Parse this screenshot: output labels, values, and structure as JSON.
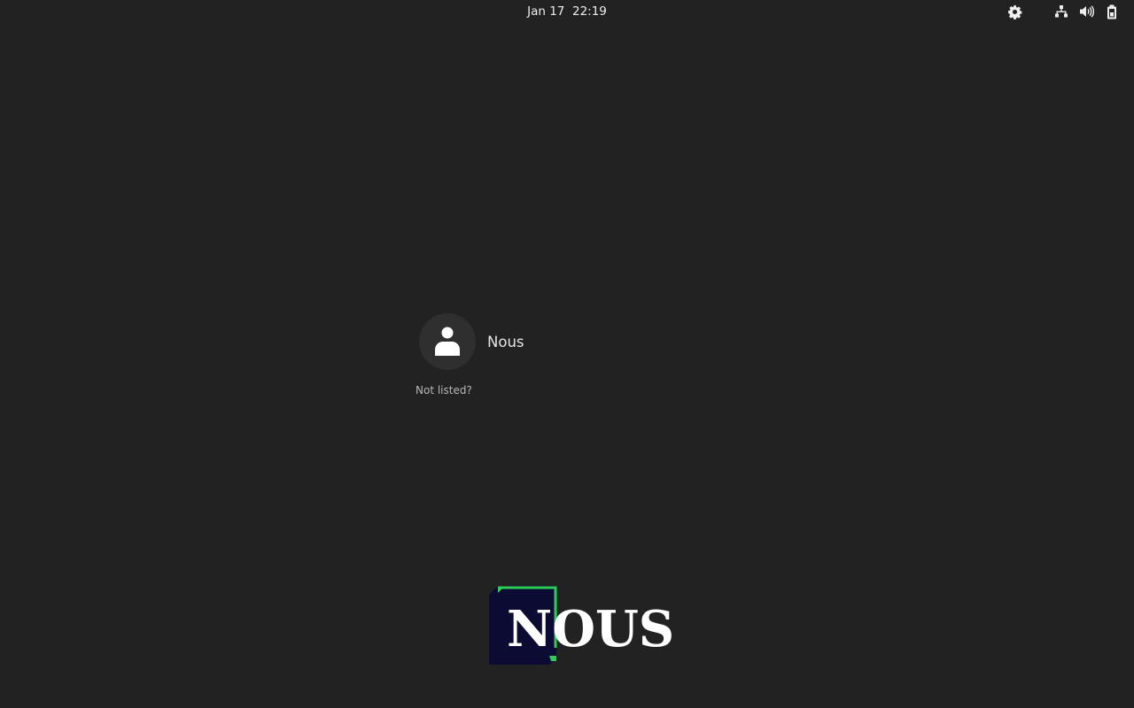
{
  "top_bar": {
    "date": "Jan 17",
    "time": "22:19",
    "icons": {
      "settings": "gear-icon",
      "network": "network-icon",
      "volume": "speaker-icon",
      "battery": "battery-icon"
    }
  },
  "login": {
    "users": [
      {
        "name": "Nous",
        "avatar": "person-icon"
      }
    ],
    "not_listed_label": "Not listed?"
  },
  "logo": {
    "text": "NOUS",
    "colors": {
      "square": "#0b0b33",
      "accent": "#2ecc55",
      "text": "#ffffff"
    }
  },
  "colors": {
    "background": "#222222",
    "avatar_bg": "#2f2f2f"
  }
}
